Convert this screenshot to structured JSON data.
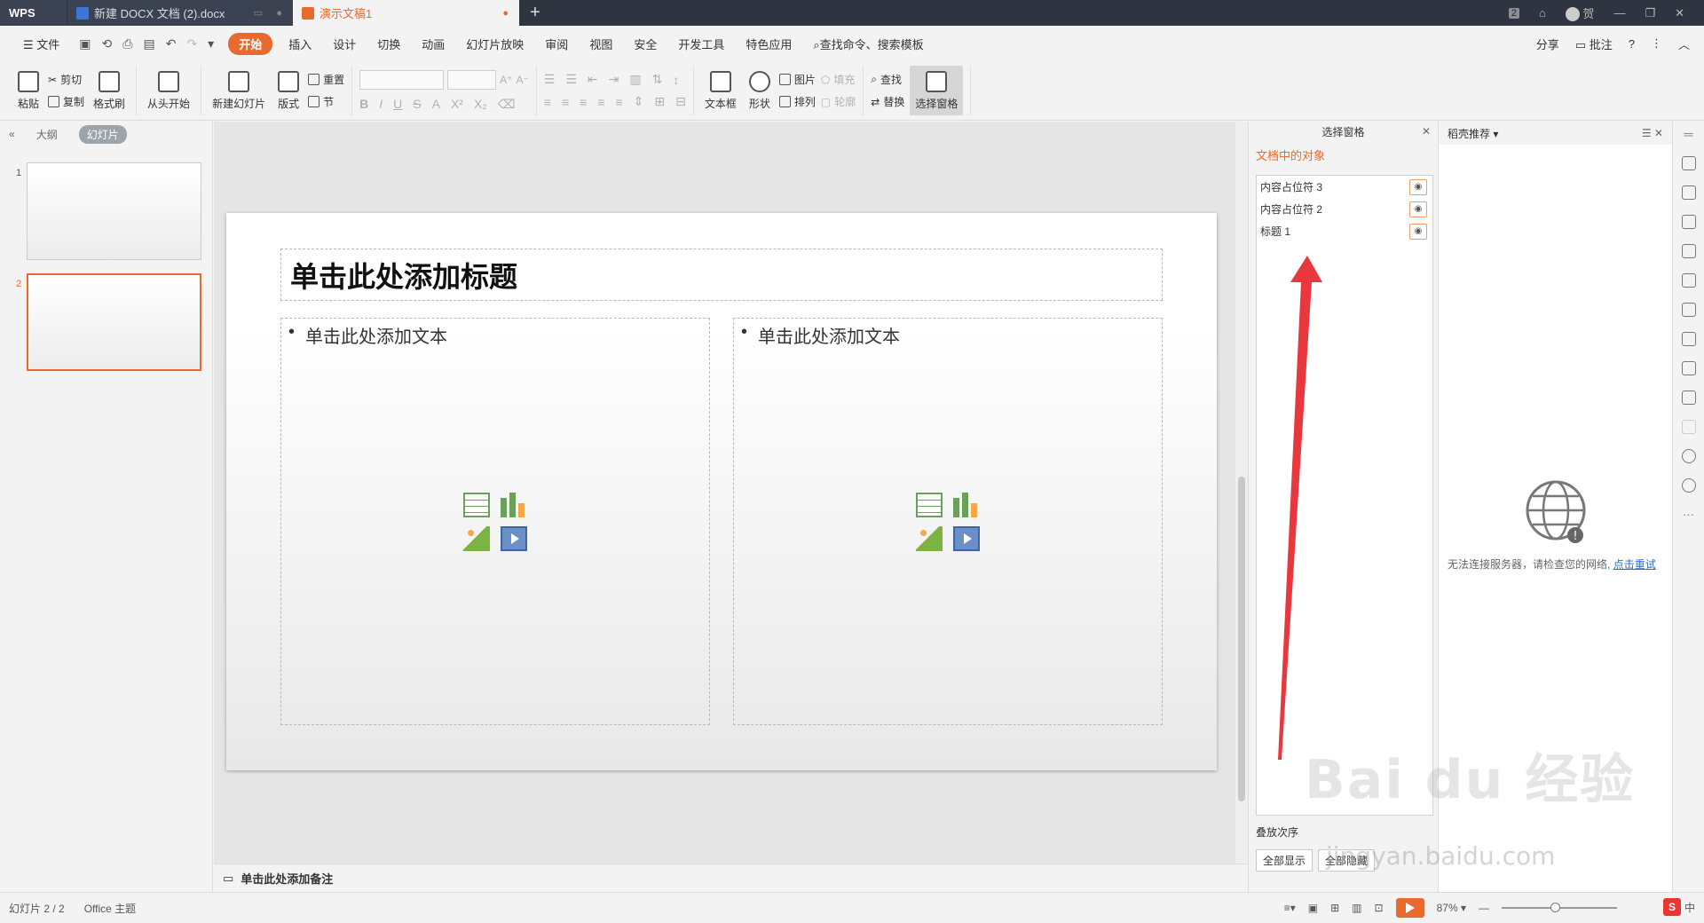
{
  "tabs": [
    {
      "label": "WPS"
    },
    {
      "label": "新建 DOCX 文档 (2).docx"
    },
    {
      "label": "演示文稿1"
    }
  ],
  "titlebar_right": {
    "badge": "2",
    "user": "贺"
  },
  "menu": {
    "file": "文件",
    "items": [
      "开始",
      "插入",
      "设计",
      "切换",
      "动画",
      "幻灯片放映",
      "审阅",
      "视图",
      "安全",
      "开发工具",
      "特色应用"
    ],
    "search": "查找命令、搜索模板",
    "share": "分享",
    "comment": "批注"
  },
  "ribbon": {
    "paste": "粘贴",
    "cut": "剪切",
    "copy": "复制",
    "format_painter": "格式刷",
    "from_start": "从头开始",
    "new_slide": "新建幻灯片",
    "layout": "版式",
    "reset": "重置",
    "section": "节",
    "textbox": "文本框",
    "shape": "形状",
    "picture": "图片",
    "fill": "填充",
    "arrange": "排列",
    "outline": "轮廓",
    "find": "查找",
    "replace": "替换",
    "selection_pane": "选择窗格"
  },
  "left_panel": {
    "tab_outline": "大纲",
    "tab_slides": "幻灯片",
    "slides": [
      {
        "num": "1"
      },
      {
        "num": "2"
      }
    ]
  },
  "slide": {
    "title_placeholder": "单击此处添加标题",
    "body_left": "单击此处添加文本",
    "body_right": "单击此处添加文本"
  },
  "notes": {
    "placeholder": "单击此处添加备注"
  },
  "selection_pane": {
    "title": "选择窗格",
    "subtitle": "文档中的对象",
    "objects": [
      "内容占位符 3",
      "内容占位符 2",
      "标题 1"
    ],
    "order_label": "叠放次序",
    "show_all": "全部显示",
    "hide_all": "全部隐藏"
  },
  "recommend_pane": {
    "title": "稻壳推荐",
    "error_msg": "无法连接服务器，请检查您的网络,",
    "retry": "点击重试"
  },
  "statusbar": {
    "slide_counter": "幻灯片 2 / 2",
    "theme": "Office 主题",
    "zoom": "87%"
  },
  "watermark": {
    "brand": "Bai du 经验",
    "url": "jingyan.baidu.com"
  },
  "ime": {
    "lang": "中"
  },
  "colors": {
    "accent": "#e96a2e",
    "titlebar": "#2e3440",
    "link": "#2b6cc4",
    "arrow": "#e8383d"
  }
}
